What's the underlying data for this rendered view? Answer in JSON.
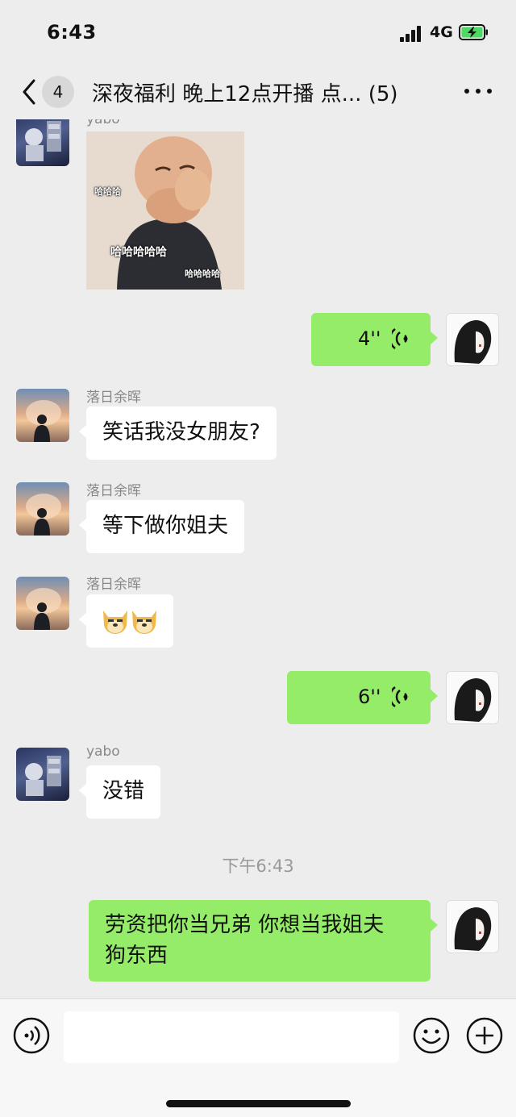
{
  "status_bar": {
    "time": "6:43",
    "network": "4G"
  },
  "nav": {
    "unread_count": "4",
    "title": "深夜福利 晚上12点开播 点...",
    "member_count": "(5)"
  },
  "messages": {
    "m1": {
      "sender": "yabo",
      "type": "sticker",
      "sticker_captions": [
        "哈哈哈",
        "哈哈哈哈哈",
        "哈哈哈哈"
      ]
    },
    "m2": {
      "direction": "out",
      "type": "voice",
      "duration": "4''"
    },
    "m3": {
      "sender": "落日余晖",
      "text": "笑话我没女朋友?"
    },
    "m4": {
      "sender": "落日余晖",
      "text": "等下做你姐夫"
    },
    "m5": {
      "sender": "落日余晖",
      "type": "emoji",
      "emoji": "doge x2"
    },
    "m6": {
      "direction": "out",
      "type": "voice",
      "duration": "6''"
    },
    "m7": {
      "sender": "yabo",
      "text": "没错"
    },
    "timestamp": "下午6:43",
    "m8": {
      "direction": "out",
      "line1": "劳资把你当兄弟 你想当我姐夫",
      "line2": "狗东西"
    }
  },
  "input_bar": {
    "placeholder": ""
  },
  "colors": {
    "background": "#ededed",
    "outgoing_bubble": "#95ec69",
    "incoming_bubble": "#ffffff",
    "battery_charging": "#4cd964"
  }
}
